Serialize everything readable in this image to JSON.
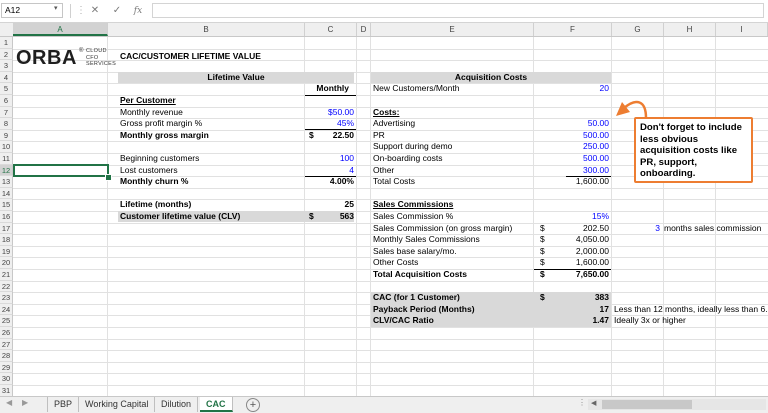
{
  "formula_bar": {
    "name_box": "A12",
    "fx_label": "fx",
    "cancel_icon": "close-icon",
    "enter_icon": "check-icon",
    "formula_value": ""
  },
  "columns": [
    "A",
    "B",
    "C",
    "D",
    "E",
    "F",
    "G",
    "H",
    "I"
  ],
  "rows": [
    "1",
    "2",
    "3",
    "4",
    "5",
    "6",
    "7",
    "8",
    "9",
    "10",
    "11",
    "12",
    "13",
    "14",
    "15",
    "16",
    "17",
    "18",
    "19",
    "20",
    "21",
    "22",
    "23",
    "24",
    "25",
    "26",
    "27",
    "28",
    "29",
    "30",
    "31"
  ],
  "logo": {
    "text": "ORBA",
    "reg": "®",
    "line1": "CLOUD",
    "line2": "CFO",
    "line3": "SERVICES"
  },
  "sheet": {
    "title": "CAC/CUSTOMER LIFETIME VALUE",
    "lifetime_header": "Lifetime Value",
    "acq_header": "Acquisition Costs",
    "monthly_label": "Monthly",
    "per_customer": "Per Customer",
    "monthly_revenue_label": "Monthly revenue",
    "monthly_revenue_value": "$50.00",
    "gpm_label": "Gross profit margin %",
    "gpm_value": "45%",
    "mgm_label": "Monthly gross margin",
    "mgm_dollar": "$",
    "mgm_value": "22.50",
    "begin_cust_label": "Beginning customers",
    "begin_cust_value": "100",
    "lost_cust_label": "Lost customers",
    "lost_cust_value": "4",
    "churn_label": "Monthly churn %",
    "churn_value": "4.00%",
    "lifetime_label": "Lifetime (months)",
    "lifetime_value": "25",
    "clv_label": "Customer lifetime value (CLV)",
    "clv_dollar": "$",
    "clv_value": "563",
    "new_cust_label": "New Customers/Month",
    "new_cust_value": "20",
    "costs_label": "Costs:",
    "advertising_label": "Advertising",
    "advertising_value": "50.00",
    "pr_label": "PR",
    "pr_value": "500.00",
    "support_label": "Support during demo",
    "support_value": "250.00",
    "onboarding_label": "On-boarding costs",
    "onboarding_value": "500.00",
    "other_label": "Other",
    "other_value": "300.00",
    "total_costs_label": "Total Costs",
    "total_costs_value": "1,600.00",
    "sales_comm_label": "Sales Commissions",
    "sales_comm_pct_label": "Sales Commission %",
    "sales_comm_pct_value": "15%",
    "sales_comm_gm_label": "Sales Commission (on gross margin)",
    "sales_comm_gm_dollar": "$",
    "sales_comm_gm_value": "202.50",
    "months_value": "3",
    "months_label": "months sales commission",
    "monthly_sales_comm_label": "Monthly Sales Commissions",
    "monthly_sales_comm_dollar": "$",
    "monthly_sales_comm_value": "4,050.00",
    "sales_base_label": "Sales base salary/mo.",
    "sales_base_dollar": "$",
    "sales_base_value": "2,000.00",
    "other_costs_label": "Other Costs",
    "other_costs_dollar": "$",
    "other_costs_value": "1,600.00",
    "total_acq_label": "Total Acquisition Costs",
    "total_acq_dollar": "$",
    "total_acq_value": "7,650.00",
    "cac_label": "CAC (for 1 Customer)",
    "cac_dollar": "$",
    "cac_value": "383",
    "payback_label": "Payback Period (Months)",
    "payback_value": "17",
    "payback_note": "Less than 12 months, ideally less than 6.",
    "ratio_label": "CLV/CAC Ratio",
    "ratio_value": "1.47",
    "ratio_note": "Ideally 3x or higher"
  },
  "callout": {
    "text": "Don't forget to include less obvious acquisition costs like PR, support, onboarding."
  },
  "tabs": [
    "PBP",
    "Working Capital",
    "Dilution",
    "CAC"
  ],
  "active_tab": "CAC",
  "colors": {
    "excel_green": "#217346",
    "input_blue": "#0000ff",
    "callout_orange": "#ed7d31",
    "band_gray": "#d9d9d9"
  }
}
